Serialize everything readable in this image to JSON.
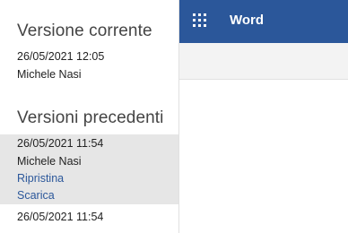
{
  "app": {
    "name": "Word"
  },
  "icons": {
    "app_launcher": "waffle-icon"
  },
  "colors": {
    "brand": "#2b579a",
    "link": "#2b579a",
    "selected_bg": "#e6e6e6"
  },
  "history": {
    "current": {
      "heading": "Versione corrente",
      "date": "26/05/2021 12:05",
      "author": "Michele Nasi"
    },
    "previous": {
      "heading": "Versioni precedenti",
      "items": [
        {
          "date": "26/05/2021 11:54",
          "author": "Michele Nasi",
          "restore_label": "Ripristina",
          "download_label": "Scarica"
        },
        {
          "date": "26/05/2021 11:54"
        }
      ]
    }
  }
}
